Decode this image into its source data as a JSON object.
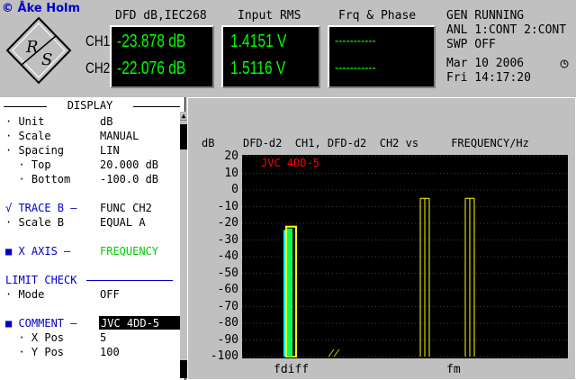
{
  "header": {
    "credit": "© Åke Holm",
    "col1_title": "DFD dB,IEC268",
    "col2_title": "Input RMS",
    "col3_title": "Frq & Phase",
    "ch1_label": "CH1",
    "ch2_label": "CH2",
    "ch1_level": "-23.878 dB",
    "ch2_level": "-22.076 dB",
    "ch1_rms": "1.4151  V",
    "ch2_rms": "1.5116  V",
    "ch1_freq": "-----------",
    "ch2_freq": "-----------",
    "status": {
      "gen": "GEN RUNNING",
      "anl": "ANL 1:CONT 2:CONT",
      "swp": "SWP OFF",
      "date": "Mar 10 2006",
      "time": "Fri  14:17:20"
    }
  },
  "panel": {
    "title": "DISPLAY",
    "rows": {
      "unit": {
        "label": "· Unit",
        "value": "dB"
      },
      "scale": {
        "label": "· Scale",
        "value": "MANUAL"
      },
      "spacing": {
        "label": "· Spacing",
        "value": "LIN"
      },
      "top": {
        "label": "  · Top",
        "value": "20.000 dB"
      },
      "bottom": {
        "label": "  · Bottom",
        "value": "-100.0 dB"
      },
      "trace_b": {
        "label": "√ TRACE B —",
        "value": "FUNC CH2"
      },
      "scale_b": {
        "label": "· Scale B",
        "value": "EQUAL A"
      },
      "x_axis": {
        "label": "■ X AXIS —",
        "value": "FREQUENCY"
      },
      "limit_check": {
        "label": "LIMIT CHECK"
      },
      "mode": {
        "label": "· Mode",
        "value": "OFF"
      },
      "comment": {
        "label": "■ COMMENT —",
        "value": "JVC 4DD-5"
      },
      "xpos": {
        "label": "  · X Pos",
        "value": "5"
      },
      "ypos": {
        "label": "  · Y Pos",
        "value": "100"
      }
    }
  },
  "chart_data": {
    "type": "bar",
    "title": "DFD-d2  CH1, DFD-d2  CH2 vs     FREQUENCY/Hz",
    "ylabel": "dB",
    "comment": "JVC 4DD-5",
    "ylim": [
      -100,
      20
    ],
    "yticks": [
      20,
      10,
      0,
      -10,
      -20,
      -30,
      -40,
      -50,
      -60,
      -70,
      -80,
      -90,
      -100
    ],
    "xlabels": [
      "fdiff",
      "fm"
    ],
    "series": [
      {
        "name": "CH1",
        "color": "#00ffff",
        "values": [
          -24,
          -100,
          -100
        ]
      },
      {
        "name": "CH2",
        "color": "#ffff00",
        "values": [
          -22,
          -5,
          -5
        ]
      }
    ],
    "grid": true
  }
}
